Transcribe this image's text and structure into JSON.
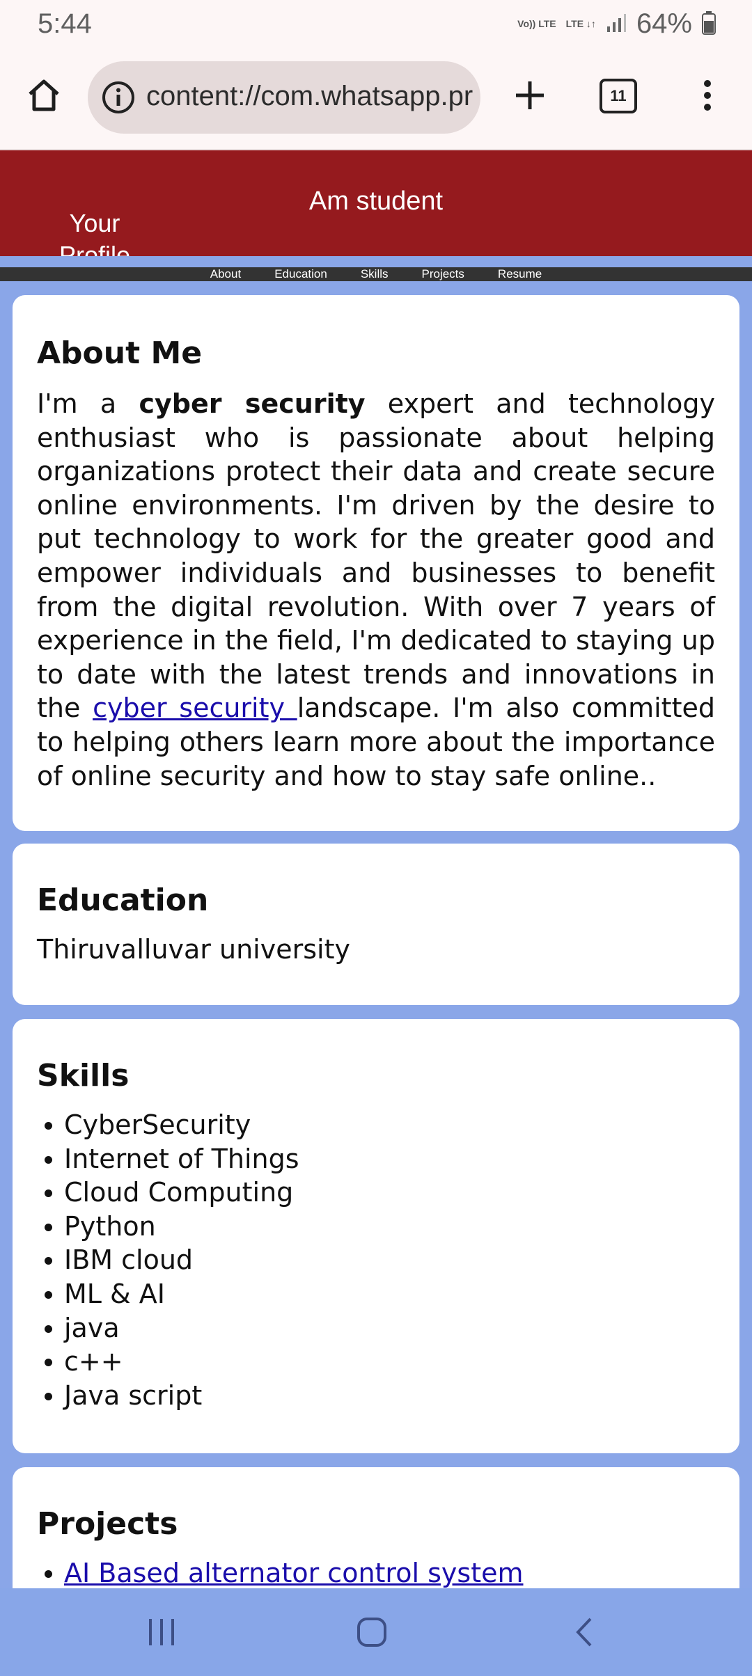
{
  "status_bar": {
    "time": "5:44",
    "net1": "Vo)) LTE",
    "net2": "LTE ↓↑",
    "battery": "64%"
  },
  "browser": {
    "url": "content://com.whatsapp.pr",
    "tab_count": "11",
    "icons": [
      "home-icon",
      "info-icon",
      "plus-icon",
      "tabs-icon",
      "more-vert-icon"
    ]
  },
  "header": {
    "title": "Am student",
    "profile_alt": "Your Profile Image"
  },
  "nav": {
    "items": [
      "About",
      "Education",
      "Skills",
      "Projects",
      "Resume"
    ]
  },
  "about": {
    "heading": "About Me",
    "p1": "I'm a ",
    "bold": "cyber security",
    "p2": " expert and technology enthusiast who is passionate about helping organizations protect their data and create secure online environments. I'm driven by the desire to put technology to work for the greater good and empower individuals and businesses to benefit from the digital revolution. With over 7 years of experience in the field, I'm dedicated to staying up to date with the latest trends and innovations in the ",
    "link": "cyber security ",
    "p3": "landscape. I'm also committed to helping others learn more about the importance of online security and how to stay safe online.."
  },
  "education": {
    "heading": "Education",
    "text": "Thiruvalluvar university"
  },
  "skills": {
    "heading": "Skills",
    "items": [
      "CyberSecurity",
      "Internet of Things",
      "Cloud Computing",
      "Python",
      "IBM cloud",
      "ML & AI",
      "java",
      "c++",
      "Java script"
    ]
  },
  "projects": {
    "heading": "Projects",
    "items": [
      "AI Based alternator control system"
    ]
  },
  "system_nav": {
    "icons": [
      "recents-icon",
      "home-key-icon",
      "back-icon"
    ]
  },
  "colors": {
    "header_bg": "#951a1e",
    "page_bg": "#8aa6e8",
    "nav_bg": "#333333",
    "link": "#1a0dab"
  }
}
